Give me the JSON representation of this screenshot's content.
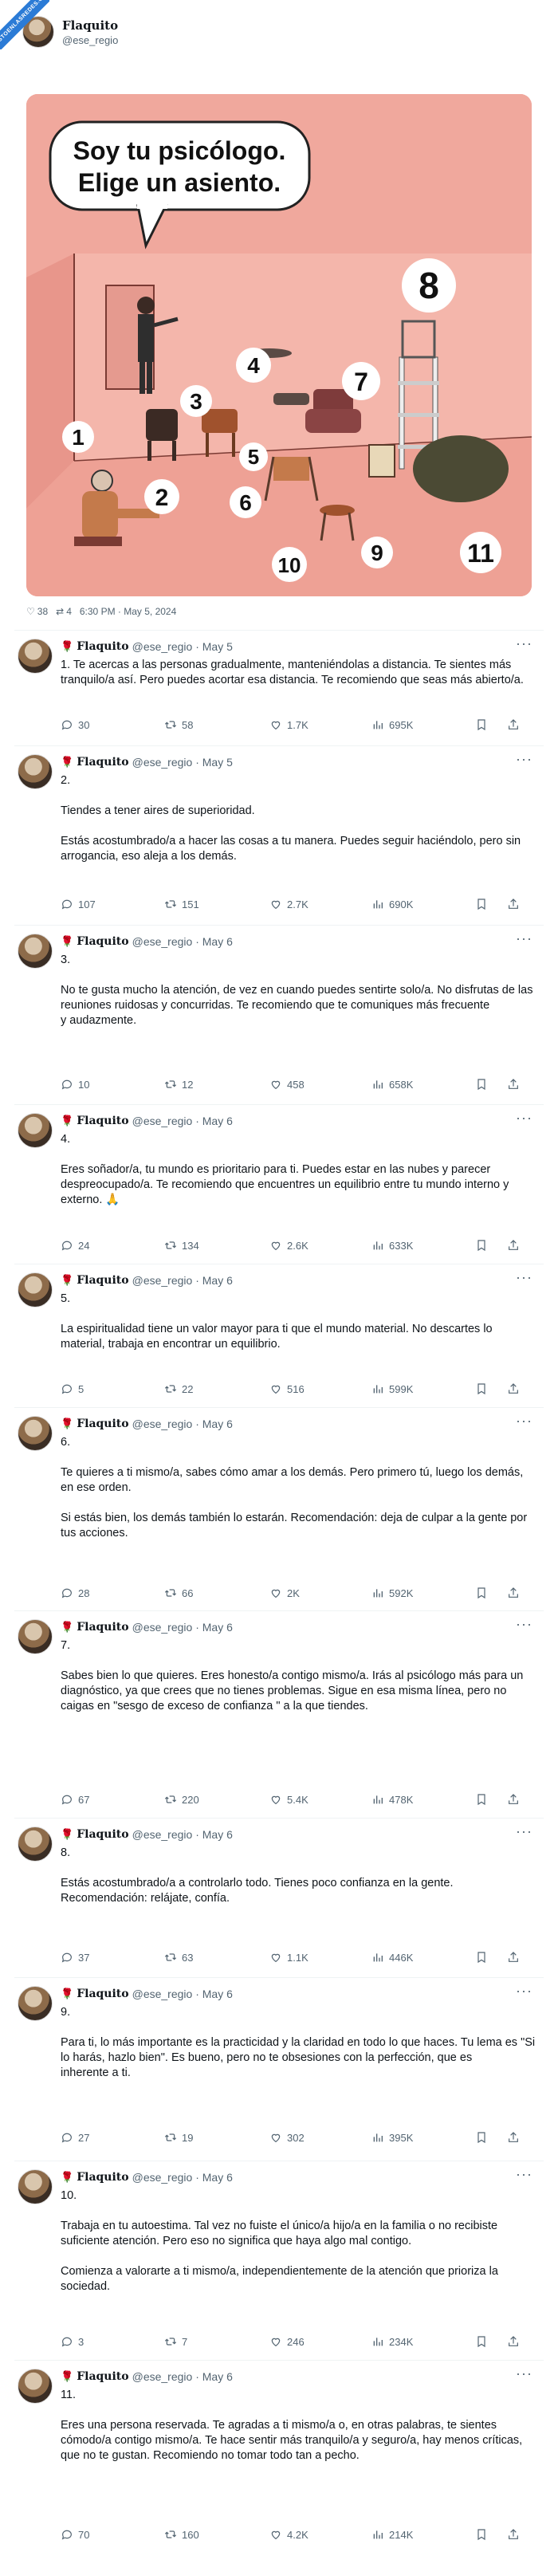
{
  "watermark": "VISTOENLASREDES.COM",
  "author": {
    "name": "Flaquito",
    "handle": "@ese_regio"
  },
  "illustration": {
    "speech": [
      "Soy tu psicólogo.",
      "Elige un asiento."
    ],
    "seat_numbers": [
      "1",
      "2",
      "3",
      "4",
      "5",
      "6",
      "7",
      "8",
      "9",
      "10",
      "11"
    ]
  },
  "post_meta": {
    "likes": "38",
    "retweets": "4",
    "timestamp": "6:30 PM · May 5, 2024"
  },
  "replies": [
    {
      "name": "Flaquito",
      "handle": "@ese_regio · May 5",
      "text": "1. Te acercas a las personas gradualmente, manteniéndolas a distancia. Te sientes más tranquilo/a así. Pero puedes acortar esa distancia. Te recomiendo que seas más abierto/a.",
      "replies": "30",
      "retweets": "58",
      "likes": "1.7K",
      "views": "695K"
    },
    {
      "name": "Flaquito",
      "handle": "@ese_regio · May 5",
      "text": "2.\n\nTiendes a tener aires de superioridad.\n\nEstás acostumbrado/a a hacer las cosas a tu manera. Puedes seguir haciéndolo, pero sin arrogancia, eso aleja a los demás.",
      "replies": "107",
      "retweets": "151",
      "likes": "2.7K",
      "views": "690K"
    },
    {
      "name": "Flaquito",
      "handle": "@ese_regio · May 6",
      "text": "3.\n\nNo te gusta mucho la atención, de vez en cuando puedes sentirte solo/a. No disfrutas de las reuniones ruidosas y concurridas. Te recomiendo que te comuniques más frecuente\ny audazmente.",
      "replies": "10",
      "retweets": "12",
      "likes": "458",
      "views": "658K"
    },
    {
      "name": "Flaquito",
      "handle": "@ese_regio · May 6",
      "text": "4.\n\nEres soñador/a, tu mundo es prioritario para ti. Puedes estar en las nubes y parecer despreocupado/a. Te recomiendo que encuentres un equilibrio entre tu mundo interno y externo. 🙏",
      "replies": "24",
      "retweets": "134",
      "likes": "2.6K",
      "views": "633K"
    },
    {
      "name": "Flaquito",
      "handle": "@ese_regio · May 6",
      "text": "5.\n\nLa espiritualidad tiene un valor mayor para ti que el mundo material. No descartes lo material, trabaja en encontrar un equilibrio.",
      "replies": "5",
      "retweets": "22",
      "likes": "516",
      "views": "599K"
    },
    {
      "name": "Flaquito",
      "handle": "@ese_regio · May 6",
      "text": "6.\n\nTe quieres a ti mismo/a, sabes cómo amar a los demás. Pero primero tú, luego los demás, en ese orden.\n\nSi estás bien, los demás también lo estarán. Recomendación: deja de culpar a la gente por tus acciones.",
      "replies": "28",
      "retweets": "66",
      "likes": "2K",
      "views": "592K"
    },
    {
      "name": "Flaquito",
      "handle": "@ese_regio · May 6",
      "text": "7.\n\nSabes bien lo que quieres. Eres honesto/a contigo mismo/a. Irás al psicólogo más para un diagnóstico, ya que crees que no tienes problemas. Sigue en esa misma línea, pero no caigas en \"sesgo de exceso de confianza \" a la que tiendes.",
      "replies": "67",
      "retweets": "220",
      "likes": "5.4K",
      "views": "478K"
    },
    {
      "name": "Flaquito",
      "handle": "@ese_regio · May 6",
      "text": "8.\n\nEstás acostumbrado/a a controlarlo todo. Tienes poco confianza en la gente.\nRecomendación: relájate, confía.",
      "replies": "37",
      "retweets": "63",
      "likes": "1.1K",
      "views": "446K"
    },
    {
      "name": "Flaquito",
      "handle": "@ese_regio · May 6",
      "text": "9.\n\nPara ti, lo más importante es la practicidad y la claridad en todo lo que haces. Tu lema es \"Si lo harás, hazlo bien\". Es bueno, pero no te obsesiones con la perfección, que es\ninherente a ti.",
      "replies": "27",
      "retweets": "19",
      "likes": "302",
      "views": "395K"
    },
    {
      "name": "Flaquito",
      "handle": "@ese_regio · May 6",
      "text": "10.\n\nTrabaja en tu autoestima. Tal vez no fuiste el único/a hijo/a en la familia o no recibiste suficiente atención. Pero eso no significa que haya algo mal contigo.\n\nComienza a valorarte a ti mismo/a, independientemente de la atención que prioriza la sociedad.",
      "replies": "3",
      "retweets": "7",
      "likes": "246",
      "views": "234K"
    },
    {
      "name": "Flaquito",
      "handle": "@ese_regio · May 6",
      "text": "11.\n\nEres una persona reservada. Te agradas a ti mismo/a o, en otras palabras, te sientes cómodo/a contigo mismo/a. Te hace sentir más tranquilo/a y seguro/a, hay menos críticas, que no te gustan. Recomiendo no tomar todo tan a pecho.",
      "replies": "70",
      "retweets": "160",
      "likes": "4.2K",
      "views": "214K"
    }
  ]
}
